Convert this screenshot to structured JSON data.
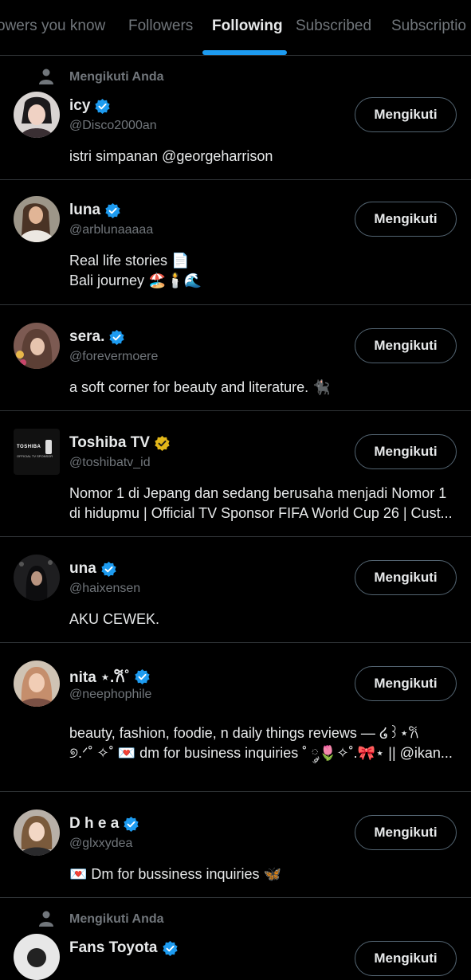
{
  "tabs": [
    {
      "label": "owers you know",
      "active": false
    },
    {
      "label": "Followers",
      "active": false
    },
    {
      "label": "Following",
      "active": true
    },
    {
      "label": "Subscribed",
      "active": false
    },
    {
      "label": "Subscriptio",
      "active": false
    }
  ],
  "follow_label": "Mengikuti",
  "colors": {
    "accent": "#1d9bf0",
    "gold_badge": "#e2b719",
    "muted": "#71767b",
    "divider": "#2f3336"
  },
  "accounts": [
    {
      "follows_you": "Mengikuti Anda",
      "name": "icy",
      "badge": "blue-verified-icon",
      "handle": "@Disco2000an",
      "bio": [
        "istri simpanan @georgeharrison"
      ],
      "button": "Mengikuti"
    },
    {
      "name": "luna",
      "badge": "blue-verified-icon",
      "handle": "@arblunaaaaa",
      "bio": [
        "Real life stories 📄",
        "Bali journey 🏖️🕯️🌊"
      ],
      "button": "Mengikuti"
    },
    {
      "name": "sera.",
      "badge": "blue-verified-icon",
      "handle": "@forevermoere",
      "bio": [
        "a soft corner for beauty and literature. 🐈‍⬛"
      ],
      "button": "Mengikuti"
    },
    {
      "name": "Toshiba TV",
      "badge": "gold-verified-icon",
      "handle": "@toshibatv_id",
      "bio": [
        "Nomor 1 di Jepang dan sedang berusaha menjadi Nomor 1",
        "di hidupmu | Official TV Sponsor FIFA World Cup 26 | Cust..."
      ],
      "avatar_text": [
        "TOSHIBA",
        "OFFICIAL TV SPONSOR"
      ],
      "button": "Mengikuti"
    },
    {
      "name": "una",
      "badge": "blue-verified-icon",
      "handle": "@haixensen",
      "bio": [
        "AKU CEWEK."
      ],
      "button": "Mengikuti"
    },
    {
      "name": "nita ⋆.𐙚˚",
      "badge": "blue-verified-icon",
      "handle": "@neephophile",
      "bio": [
        "beauty, fashion, foodie, n daily things reviews — ໒꒱⋆𐙚",
        "୭.ᐟ˚ ✧˚ 💌 dm for business inquiries ˚ ༘🌷✧˚.🎀⋆ || @ikan..."
      ],
      "button": "Mengikuti"
    },
    {
      "name": "D h e a",
      "badge": "blue-verified-icon",
      "handle": "@glxxydea",
      "bio": [
        "💌 Dm for bussiness inquiries 🦋"
      ],
      "button": "Mengikuti"
    },
    {
      "follows_you": "Mengikuti Anda",
      "name": "Fans Toyota",
      "badge": "blue-verified-icon",
      "handle": "",
      "bio": [],
      "button": "Mengikuti"
    }
  ]
}
